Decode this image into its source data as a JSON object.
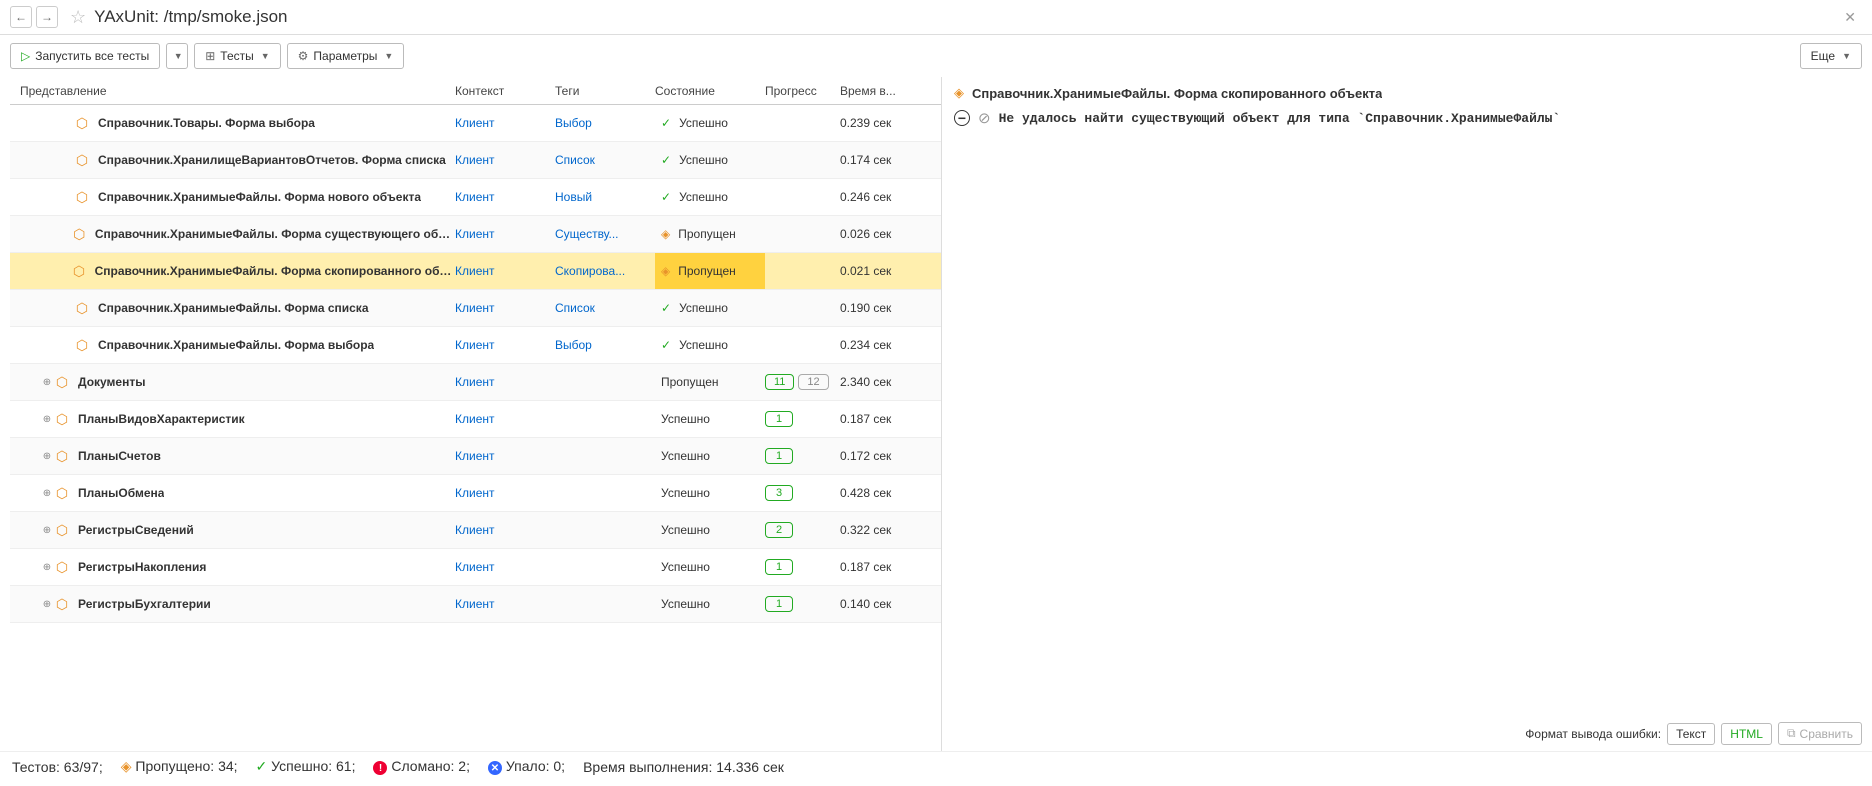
{
  "header": {
    "title": "YAxUnit: /tmp/smoke.json"
  },
  "toolbar": {
    "run_all": "Запустить все тесты",
    "tests": "Тесты",
    "params": "Параметры",
    "more": "Еще"
  },
  "columns": {
    "name": "Представление",
    "context": "Контекст",
    "tags": "Теги",
    "state": "Состояние",
    "progress": "Прогресс",
    "time": "Время в..."
  },
  "states": {
    "success": "Успешно",
    "skipped": "Пропущен"
  },
  "context_label": "Клиент",
  "rows": [
    {
      "indent": 2,
      "name": "Справочник.Товары. Форма выбора",
      "tag": "Выбор",
      "state": "success",
      "time": "0.239 сек"
    },
    {
      "indent": 2,
      "name": "Справочник.ХранилищеВариантовОтчетов. Форма списка",
      "tag": "Список",
      "state": "success",
      "time": "0.174 сек"
    },
    {
      "indent": 2,
      "name": "Справочник.ХранимыеФайлы. Форма нового объекта",
      "tag": "Новый",
      "state": "success",
      "time": "0.246 сек"
    },
    {
      "indent": 2,
      "name": "Справочник.ХранимыеФайлы. Форма существующего объекта",
      "tag": "Существу...",
      "state": "skipped",
      "time": "0.026 сек"
    },
    {
      "indent": 2,
      "name": "Справочник.ХранимыеФайлы. Форма скопированного объекта",
      "tag": "Скопирова...",
      "state": "skipped",
      "time": "0.021 сек",
      "selected": true
    },
    {
      "indent": 2,
      "name": "Справочник.ХранимыеФайлы. Форма списка",
      "tag": "Список",
      "state": "success",
      "time": "0.190 сек"
    },
    {
      "indent": 2,
      "name": "Справочник.ХранимыеФайлы. Форма выбора",
      "tag": "Выбор",
      "state": "success",
      "time": "0.234 сек"
    },
    {
      "indent": 1,
      "name": "Документы",
      "expandable": true,
      "state_text": "Пропущен",
      "prog_green": "11",
      "prog_gray": "12",
      "time": "2.340 сек"
    },
    {
      "indent": 1,
      "name": "ПланыВидовХарактеристик",
      "expandable": true,
      "state_text": "Успешно",
      "prog_green": "1",
      "time": "0.187 сек"
    },
    {
      "indent": 1,
      "name": "ПланыСчетов",
      "expandable": true,
      "state_text": "Успешно",
      "prog_green": "1",
      "time": "0.172 сек"
    },
    {
      "indent": 1,
      "name": "ПланыОбмена",
      "expandable": true,
      "state_text": "Успешно",
      "prog_green": "3",
      "time": "0.428 сек"
    },
    {
      "indent": 1,
      "name": "РегистрыСведений",
      "expandable": true,
      "state_text": "Успешно",
      "prog_green": "2",
      "time": "0.322 сек"
    },
    {
      "indent": 1,
      "name": "РегистрыНакопления",
      "expandable": true,
      "state_text": "Успешно",
      "prog_green": "1",
      "time": "0.187 сек"
    },
    {
      "indent": 1,
      "name": "РегистрыБухгалтерии",
      "expandable": true,
      "state_text": "Успешно",
      "prog_green": "1",
      "time": "0.140 сек"
    }
  ],
  "detail": {
    "title": "Справочник.ХранимыеФайлы. Форма скопированного объекта",
    "message": "Не удалось найти существующий объект для типа `Справочник.ХранимыеФайлы`"
  },
  "format": {
    "label": "Формат вывода ошибки:",
    "text": "Текст",
    "html": "HTML",
    "compare": "Сравнить"
  },
  "footer": {
    "tests": "Тестов: 63/97;",
    "skipped": "Пропущено: 34;",
    "success": "Успешно: 61;",
    "broken": "Сломано: 2;",
    "failed": "Упало: 0;",
    "duration": "Время выполнения: 14.336 сек"
  }
}
